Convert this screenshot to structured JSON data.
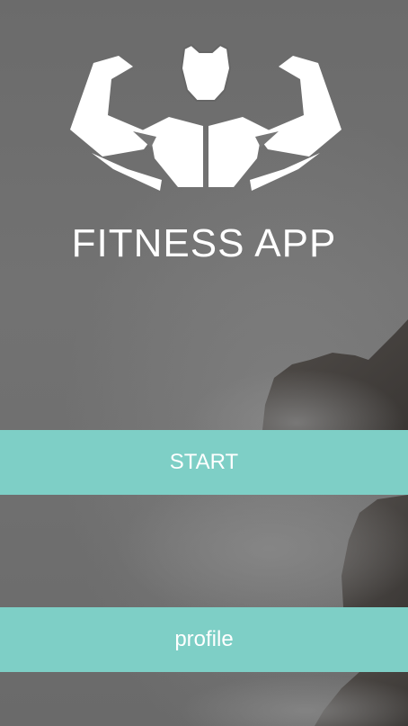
{
  "app": {
    "title": "FITNESS APP"
  },
  "logo": {
    "icon": "muscle-man-icon"
  },
  "buttons": {
    "start_label": "START",
    "profile_label": "profile"
  },
  "colors": {
    "button": "#7ecfc6",
    "text": "#ffffff",
    "background": "#6e6e6e"
  }
}
